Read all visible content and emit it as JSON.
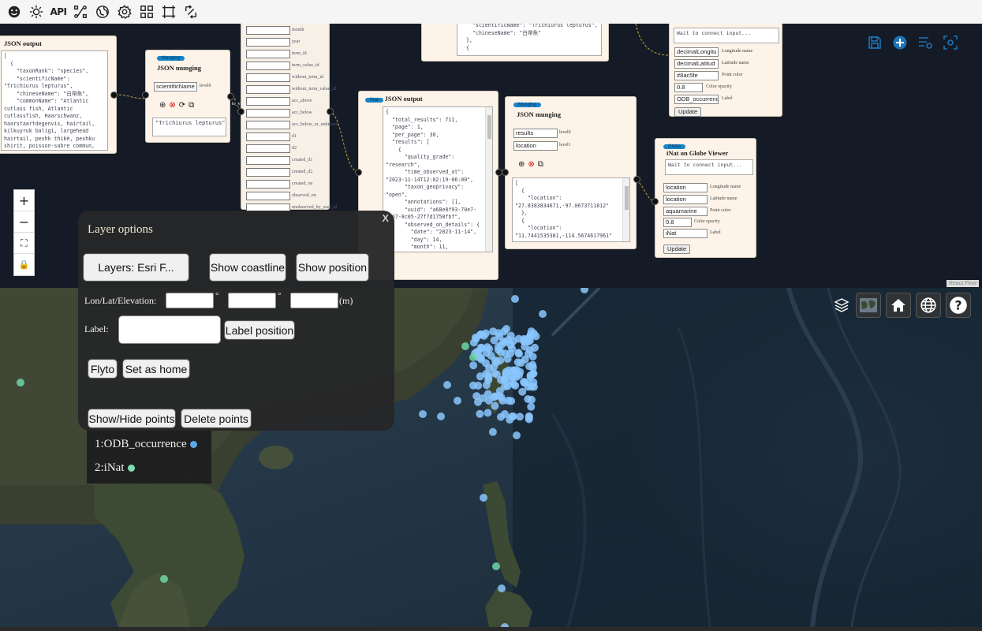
{
  "toolbar": {
    "icons": [
      "smiley-icon",
      "sun-icon",
      "api-icon",
      "flow-icon",
      "globe-icon",
      "gear-icon",
      "grid-icon",
      "frame-icon",
      "swap-icon"
    ],
    "api_label": "API"
  },
  "flow": {
    "json_output_1": {
      "title": "JSON output",
      "code": "[\n  {\n    \"taxonRank\": \"species\",\n    \"scientificName\":\n\"Trichiurus lepturus\",\n    \"chineseName\": \"白帶魚\",\n    \"commonName\": \"Atlantic\ncutlass fish, Atlantic\ncutlassfish, Haarschwanz,\nhaarstaartdegenvis, hairtail,\nkilkuyruk baligi, largehead\nhairtail, peshk thikë, peshku\nshirit, poisson-sabre commun,"
    },
    "munging_1": {
      "badge": "Munging",
      "title": "JSON munging",
      "field": "scientificName",
      "field_label": "level0",
      "output": "\"Trichiurus lepturus\""
    },
    "param_list": {
      "items": [
        "month",
        "year",
        "term_id",
        "term_value_id",
        "without_term_id",
        "without_term_value_id",
        "acc_above",
        "acc_below",
        "acc_below_or_unknown",
        "d1",
        "d2",
        "created_d1",
        "created_d2",
        "created_on",
        "observed_on",
        "unobserved_by_user_id"
      ]
    },
    "top_code": {
      "code": "    \"scientificName\": \"Trichiurus lepturus\",\n    \"chineseName\": \"白帶魚\"\n  },\n  {"
    },
    "json_output_2": {
      "badge": "iNat",
      "title": "JSON output",
      "code": "{\n  \"total_results\": 711,\n  \"page\": 1,\n  \"per_page\": 30,\n  \"results\": [\n    {\n      \"quality_grade\":\n\"research\",\n      \"time_observed_at\":\n\"2023-11-14T12:02:19-06:00\",\n      \"taxon_geoprivacy\":\n\"open\",\n      \"annotations\": [],\n      \"uuid\": \"a68e8f93-70e7-\n4b67-8c05-27f7d1758fbf\",\n      \"observed_on_details\": {\n        \"date\": \"2023-11-14\",\n        \"day\": 14,\n        \"month\": 11,"
    },
    "munging_2": {
      "badge": "Munging",
      "title": "JSON munging",
      "field0": "results",
      "field0_label": "level0",
      "field1": "location",
      "field1_label": "level1",
      "code": "[\n  {\n    \"location\":\n\"27.8383834671,-97.0673711812\"\n  },\n  {\n    \"location\":\n\"11.7441535381,-114.5674617961\""
    },
    "globe_viewer_1": {
      "textarea": "Wait to connect input...",
      "lon_value": "decimalLongitu",
      "lon_label": "Longitude name",
      "lat_value": "decimalLatitud",
      "lat_label": "Latitude name",
      "color_value": "#8ac5fe",
      "color_label": "Point color",
      "opacity_value": "0.8",
      "opacity_label": "Color opacity",
      "label_value": "ODB_occurrence",
      "label_label": "Label",
      "update": "Update"
    },
    "globe_viewer_2": {
      "badge": "Globe",
      "title": "iNat on Globe Viewer",
      "textarea": "Wait to connect input...",
      "lon_value": "location",
      "lon_label": "Longitude name",
      "lat_value": "location",
      "lat_label": "Latitude name",
      "color_value": "aquamarine",
      "color_label": "Point color",
      "opacity_value": "0.8",
      "opacity_label": "Color opacity",
      "label_value": "iNat",
      "label_label": "Label",
      "update": "Update"
    },
    "edge_label": "to_va",
    "controls": [
      "+",
      "−",
      "⛶",
      "🔒"
    ],
    "attribution": "React Flow"
  },
  "layer_options": {
    "title": "Layer options",
    "close": "X",
    "layers_button": "Layers: Esri F...",
    "show_coastline": "Show coastline",
    "show_position": "Show position",
    "lonlat_label": "Lon/Lat/Elevation:",
    "degree": "°",
    "meter": "(m)",
    "label_label": "Label:",
    "label_position": "Label position",
    "flyto": "Flyto",
    "set_as_home": "Set as home",
    "show_hide_points": "Show/Hide points",
    "delete_points": "Delete points"
  },
  "legend": {
    "items": [
      {
        "label": "1:ODB_occurrence",
        "color": "#5aa8e8"
      },
      {
        "label": "2:iNat",
        "color": "#7fdcb0"
      }
    ]
  },
  "colors": {
    "odb_point": "#8ac5fe",
    "inat_point": "#7fffd4"
  }
}
